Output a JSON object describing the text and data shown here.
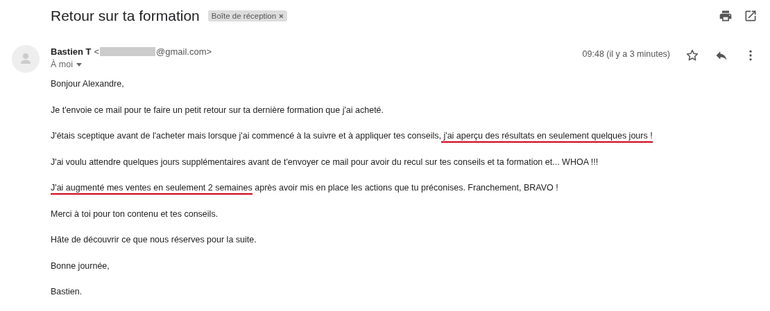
{
  "subject": "Retour sur ta formation",
  "label": {
    "text": "Boîte de réception",
    "close": "×"
  },
  "sender": {
    "name": "Bastien T",
    "email_prefix": "<",
    "email_suffix": "@gmail.com>",
    "recipient": "À moi",
    "time": "09:48 (il y a 3 minutes)"
  },
  "body": [
    [
      {
        "text": "Bonjour Alexandre,",
        "underlined": false
      }
    ],
    [
      {
        "text": "Je t'envoie ce mail pour te faire un petit retour sur ta dernière formation que j'ai acheté.",
        "underlined": false
      }
    ],
    [
      {
        "text": "J'étais sceptique avant de l'acheter mais lorsque j'ai commencé à la suivre et à appliquer tes conseils,",
        "underlined": false
      },
      {
        "text": " j'ai aperçu des résultats en seulement quelques jours !",
        "underlined": true
      }
    ],
    [
      {
        "text": "J'ai voulu attendre quelques jours supplémentaires avant de t'envoyer ce mail pour avoir du recul sur tes conseils et ta formation et... WHOA !!!",
        "underlined": false
      }
    ],
    [
      {
        "text": "J'ai augmenté mes ventes en seulement 2 semaines",
        "underlined": true
      },
      {
        "text": " après avoir mis en place les actions que tu préconises. Franchement, BRAVO !",
        "underlined": false
      }
    ],
    [
      {
        "text": "Merci à toi pour ton contenu et tes conseils.",
        "underlined": false
      }
    ],
    [
      {
        "text": "Hâte de découvrir ce que nous réserves pour la suite.",
        "underlined": false
      }
    ],
    [
      {
        "text": "Bonne journée,",
        "underlined": false
      }
    ],
    [
      {
        "text": "Bastien.",
        "underlined": false
      }
    ]
  ]
}
